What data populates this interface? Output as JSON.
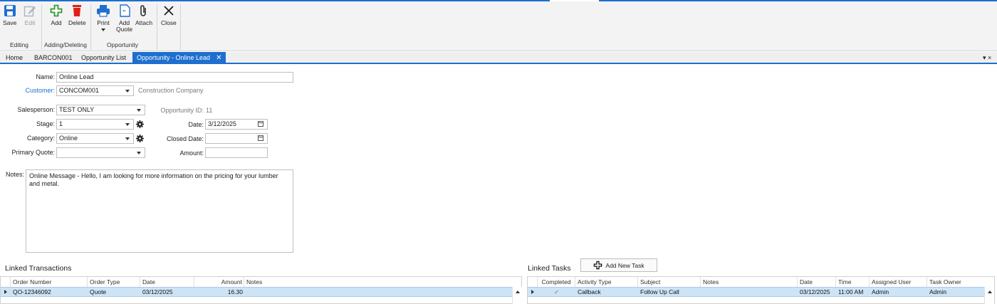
{
  "ribbon": {
    "save": "Save",
    "edit": "Edit",
    "add": "Add",
    "delete": "Delete",
    "print": "Print",
    "add_quote_line1": "Add",
    "add_quote_line2": "Quote",
    "attach": "Attach",
    "close": "Close",
    "groups": {
      "editing": "Editing",
      "adding_deleting": "Adding/Deleting",
      "opportunity": "Opportunity"
    }
  },
  "tabs": [
    {
      "label": "Home"
    },
    {
      "label": "BARCON001"
    },
    {
      "label": "Opportunity List"
    },
    {
      "label": "Opportunity - Online Lead",
      "active": true
    }
  ],
  "window_ctrl": "▾ ×",
  "form": {
    "name_label": "Name:",
    "name_value": "Online Lead",
    "customer_label": "Customer:",
    "customer_value": "CONCOM001",
    "customer_name": "Construction Company",
    "salesperson_label": "Salesperson:",
    "salesperson_value": "TEST ONLY",
    "opportunity_id_label": "Opportunity ID:",
    "opportunity_id_value": "11",
    "stage_label": "Stage:",
    "stage_value": "1",
    "date_label": "Date:",
    "date_value": "3/12/2025",
    "category_label": "Category:",
    "category_value": "Online",
    "closed_date_label": "Closed Date:",
    "closed_date_value": "",
    "primary_quote_label": "Primary Quote:",
    "primary_quote_value": "",
    "amount_label": "Amount:",
    "amount_value": "",
    "notes_label": "Notes:",
    "notes_value": "Online Message - Hello, I am looking for more information on the pricing for your lumber and metal."
  },
  "linked_transactions": {
    "title": "Linked Transactions",
    "columns": [
      "Order Number",
      "Order Type",
      "Date",
      "Amount",
      "Notes"
    ],
    "rows": [
      {
        "order_number": "QO-12346092",
        "order_type": "Quote",
        "date": "03/12/2025",
        "amount": "16.30",
        "notes": ""
      }
    ]
  },
  "linked_tasks": {
    "title": "Linked Tasks",
    "add_button": "Add New Task",
    "columns": [
      "Completed",
      "Activity Type",
      "Subject",
      "Notes",
      "Date",
      "Time",
      "Assigned User",
      "Task Owner"
    ],
    "rows": [
      {
        "completed": "✔",
        "activity_type": "Callback",
        "subject": "Follow Up Call",
        "notes": "",
        "date": "03/12/2025",
        "time": "11:00 AM",
        "assigned_user": "Admin",
        "task_owner": "Admin"
      }
    ]
  },
  "colors": {
    "accent": "#1e6fcf",
    "selected_row": "#cde4f7",
    "delete_red": "#e0201b",
    "add_green": "#3aa335"
  }
}
